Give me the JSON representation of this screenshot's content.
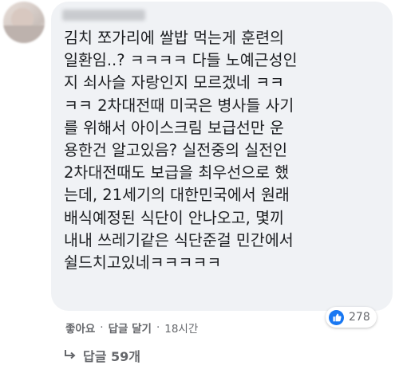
{
  "comment": {
    "author_avatar": "blurred-avatar",
    "author_name": "",
    "lines": [
      "김치 쪼가리에 쌀밥 먹는게 훈련의",
      "일환임..? ㅋㅋㅋㅋ 다들 노예근성인",
      "지 쇠사슬 자랑인지 모르겠네 ㅋㅋ",
      "ㅋㅋ 2차대전때 미국은 병사들 사기",
      "를 위해서 아이스크림 보급선만 운",
      "용한건 알고있음? 실전중의 실전인",
      "2차대전때도 보급을 최우선으로 했",
      "는데, 21세기의 대한민국에서 원래",
      "배식예정된 식단이 안나오고, 몇끼",
      "내내 쓰레기같은 식단준걸 민간에서",
      "쉴드치고있네ㅋㅋㅋㅋㅋ"
    ],
    "reaction": {
      "icon": "thumbs-up-icon",
      "color": "#1877f2",
      "count": "278"
    }
  },
  "actions": {
    "like": "좋아요",
    "separator": "·",
    "reply": "답글 달기",
    "time": "18시간"
  },
  "replies": {
    "icon": "reply-arrow-icon",
    "label": "답글 59개"
  }
}
